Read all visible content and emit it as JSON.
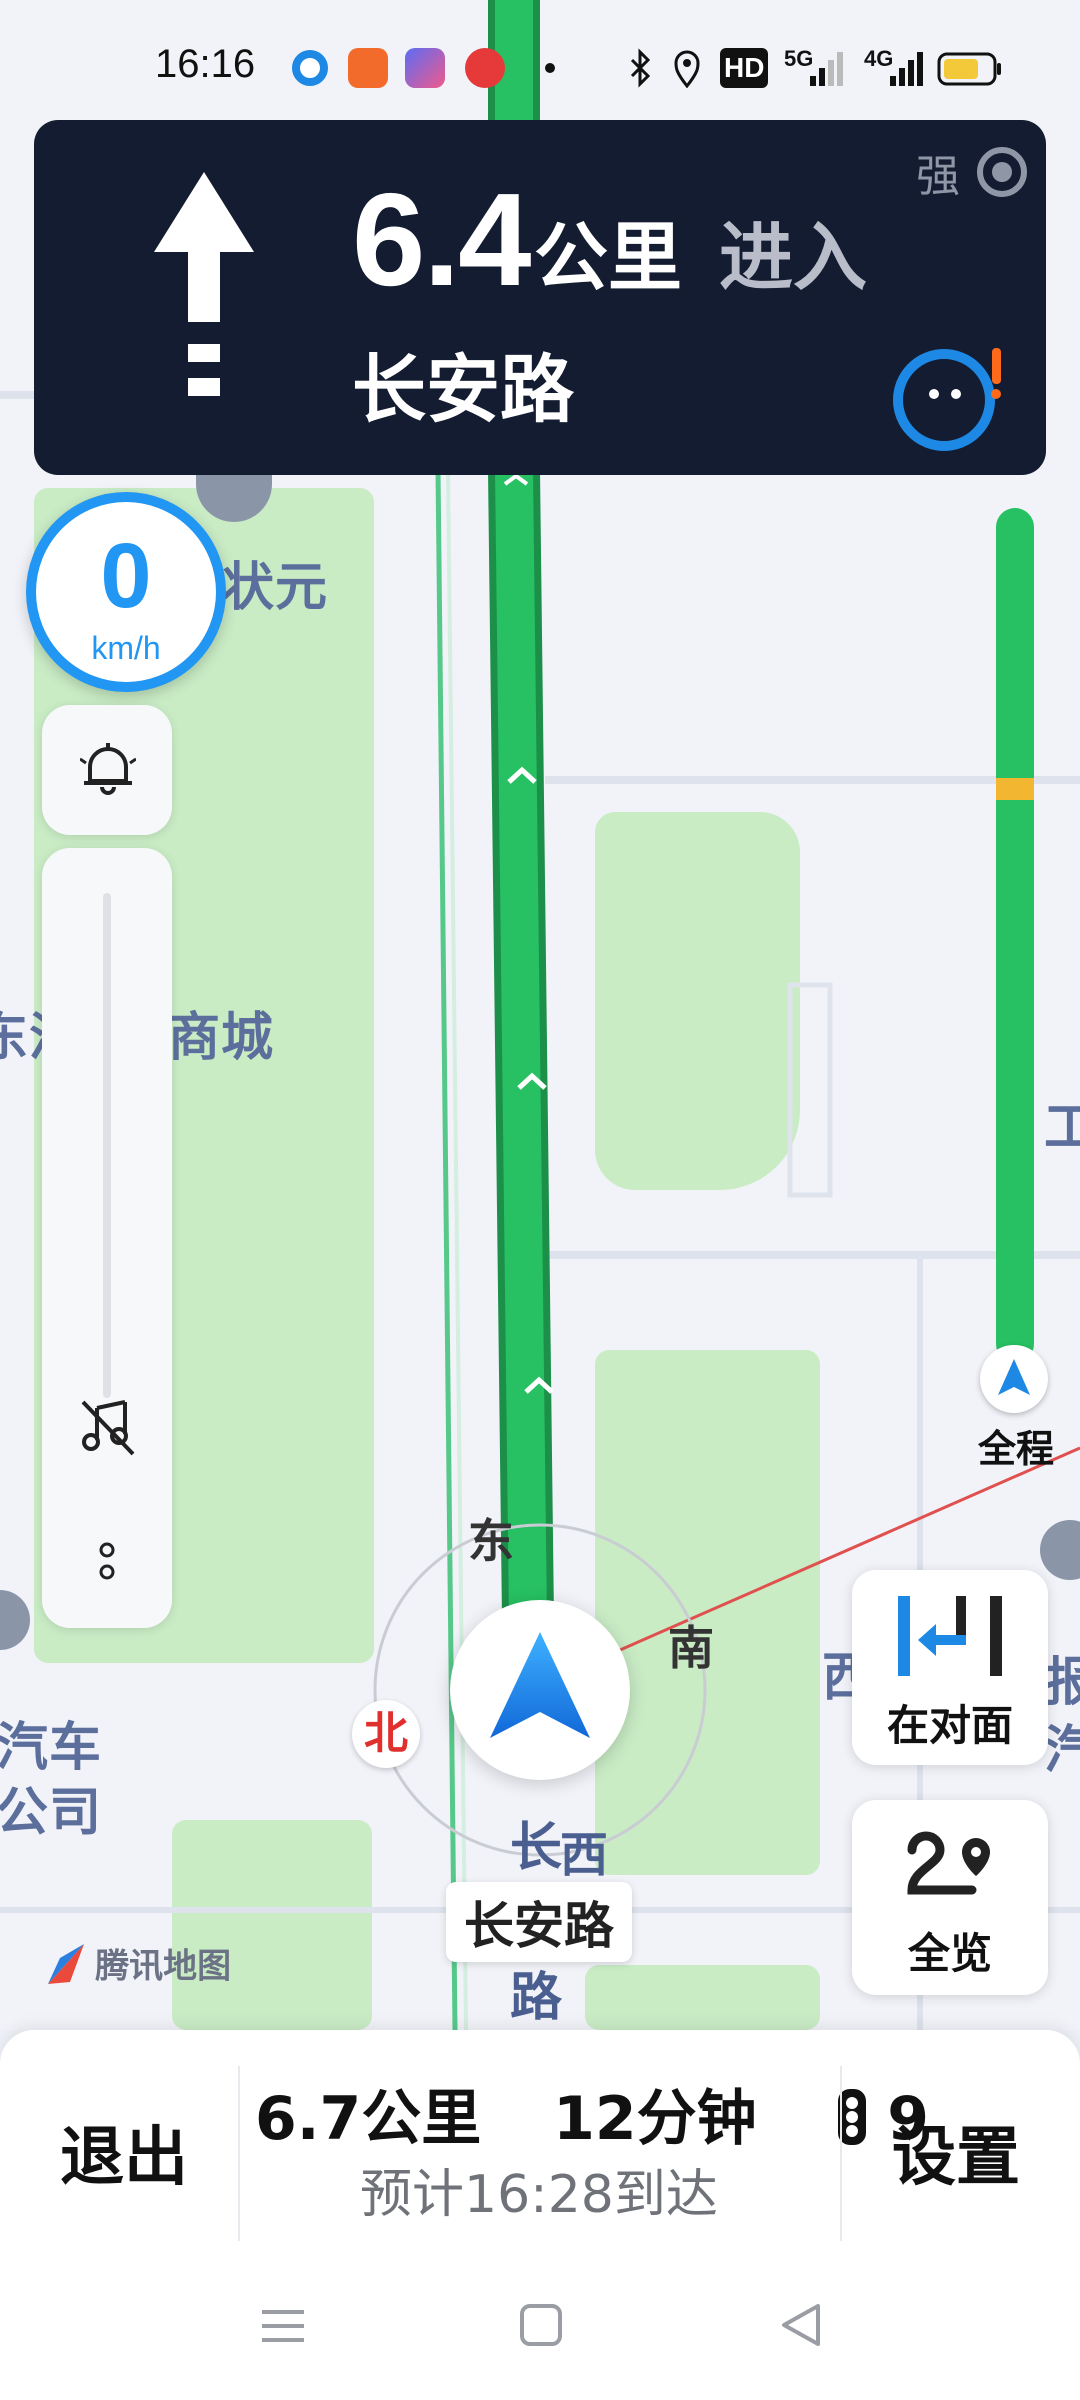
{
  "status_bar": {
    "time": "16:16",
    "network_5g": "5G",
    "network_4g": "4G",
    "hd_label": "HD",
    "icons": [
      "app-notification-icon",
      "bluetooth-icon",
      "location-icon",
      "hd-voice-icon",
      "signal-icon",
      "battery-icon"
    ]
  },
  "guidance": {
    "distance_value": "6.4",
    "distance_unit": "公里",
    "action": "进入",
    "road_name": "长安路",
    "signal_label": "强",
    "turn_icon": "straight-arrow-icon",
    "assistant_icon": "voice-assistant-icon"
  },
  "speedometer": {
    "value": "0",
    "unit": "km/h"
  },
  "side_controls": {
    "icons": [
      "bell-icon",
      "music-off-icon",
      "more-icon"
    ]
  },
  "map": {
    "labels": {
      "zhuangyuan": "状元",
      "mall": "商城",
      "mall_prefix": "东汇",
      "auto_company_1": "汽车",
      "auto_company_2": "公司",
      "west_char": "西",
      "right_partial": "工会",
      "right_partial2": "报",
      "right_partial3": "汽"
    },
    "compass": {
      "east": "东",
      "south": "南",
      "north": "北"
    },
    "road_vertical": {
      "c1": "长",
      "c2": "路",
      "c3": "西"
    },
    "current_road": "长安路",
    "brand": "腾讯地图"
  },
  "right_controls": {
    "overview_route_label": "全程",
    "opposite_label": "在对面",
    "full_view_label": "全览"
  },
  "bottom_bar": {
    "exit_label": "退出",
    "settings_label": "设置",
    "remaining_distance": "6.7公里",
    "remaining_time": "12分钟",
    "traffic_lights": "9",
    "eta": "预计16:28到达"
  },
  "colors": {
    "route_green": "#27c062",
    "panel_dark": "#141c31",
    "accent_blue": "#2196f3",
    "park_green": "#c9ecc5",
    "congestion_yellow": "#f2b630"
  }
}
